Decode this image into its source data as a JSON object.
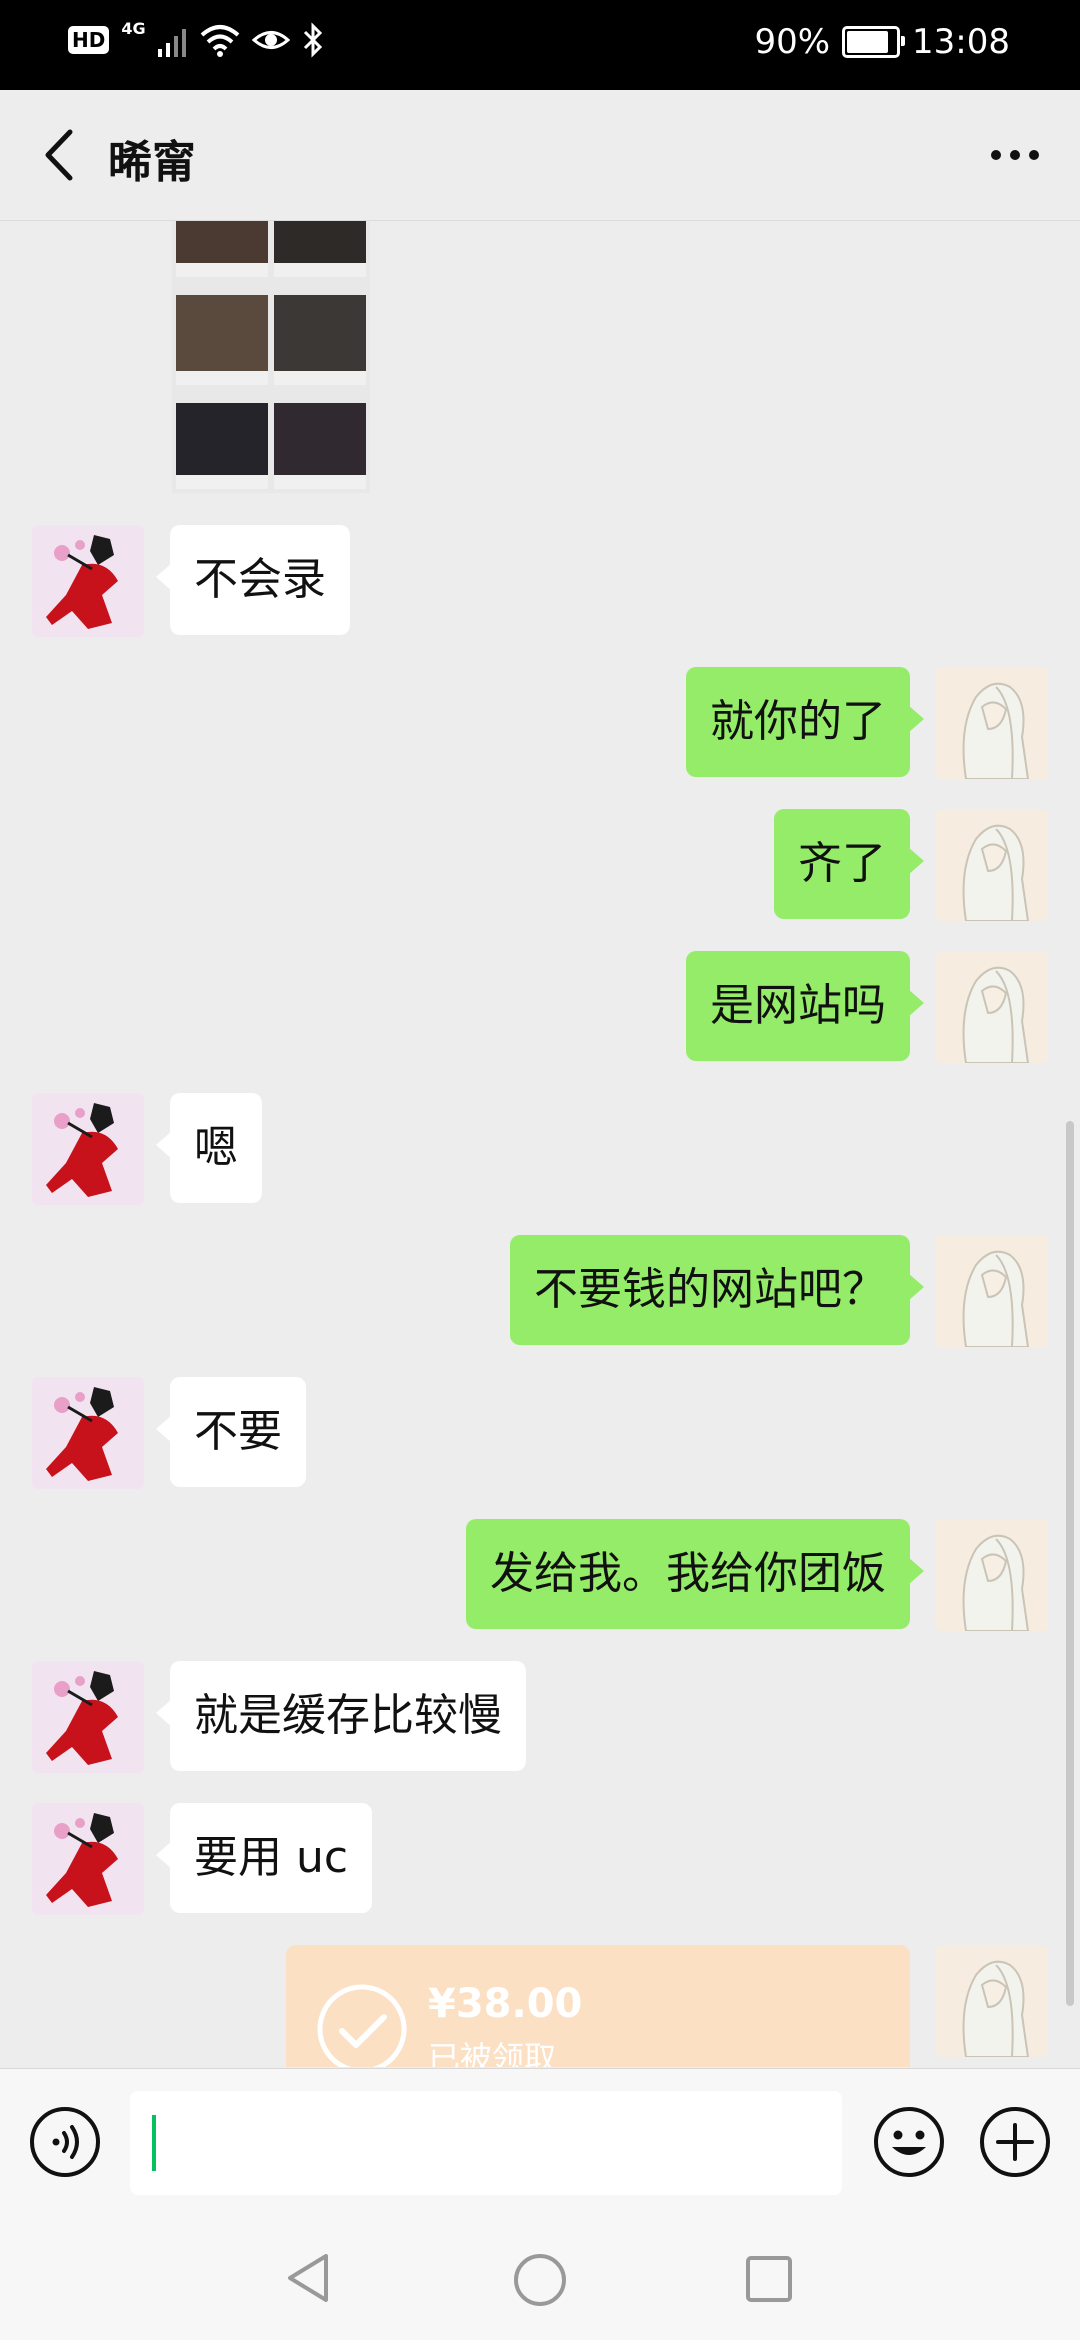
{
  "status_bar": {
    "hd": "HD",
    "network": "4G",
    "battery_percent": "90%",
    "battery_level": 0.9,
    "time": "13:08"
  },
  "header": {
    "title": "晞甯",
    "back_icon": "chevron-left-icon",
    "more_icon": "more-dots-icon"
  },
  "messages": [
    {
      "side": "in",
      "text": "不会录"
    },
    {
      "side": "out",
      "text": "就你的了"
    },
    {
      "side": "out",
      "text": "齐了"
    },
    {
      "side": "out",
      "text": "是网站吗"
    },
    {
      "side": "in",
      "text": "嗯"
    },
    {
      "side": "out",
      "text": "不要钱的网站吧？"
    },
    {
      "side": "in",
      "text": "不要"
    },
    {
      "side": "out",
      "text": "发给我。我给你团饭"
    },
    {
      "side": "in",
      "text": "就是缓存比较慢"
    },
    {
      "side": "in",
      "text": "要用 uc"
    }
  ],
  "red_packet": {
    "amount": "¥38.00",
    "status": "已被领取",
    "color": "#fbe0c4"
  },
  "input_bar": {
    "value": "",
    "voice_icon": "voice-icon",
    "emoji_icon": "emoji-icon",
    "plus_icon": "plus-icon"
  },
  "nav_bar": {
    "back_icon": "nav-back-icon",
    "home_icon": "nav-home-icon",
    "recent_icon": "nav-recent-icon"
  },
  "colors": {
    "outgoing_bubble": "#95ec69",
    "incoming_bubble": "#ffffff",
    "background": "#ededed",
    "cursor": "#07c160"
  }
}
